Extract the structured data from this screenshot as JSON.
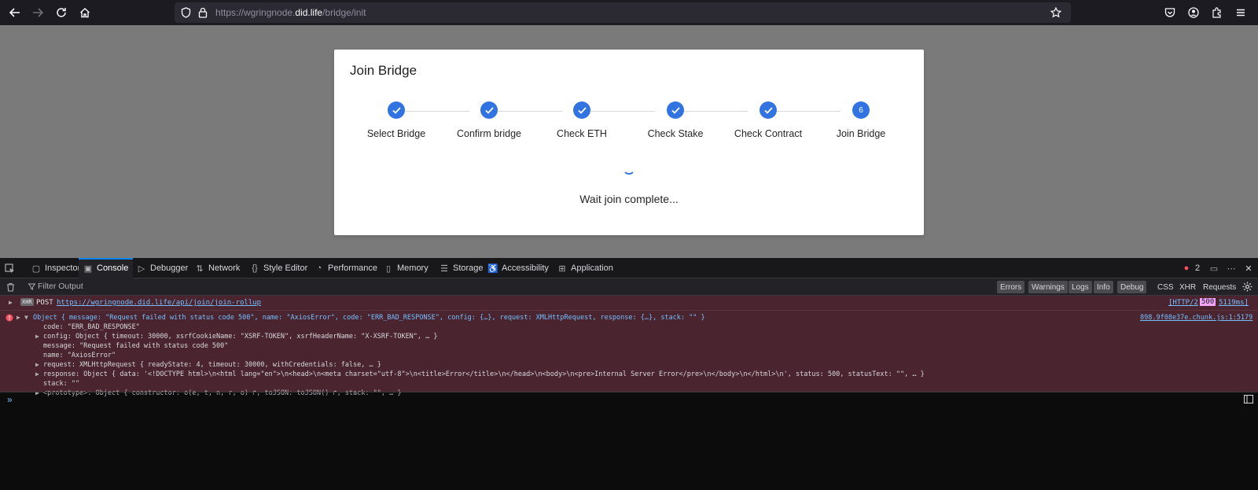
{
  "browser": {
    "url_prefix": "https://wgringnode.",
    "url_domain": "did.life",
    "url_path": "/bridge/init"
  },
  "modal": {
    "title": "Join Bridge",
    "steps": [
      {
        "label": "Select Bridge",
        "state": "done"
      },
      {
        "label": "Confirm bridge",
        "state": "done"
      },
      {
        "label": "Check ETH",
        "state": "done"
      },
      {
        "label": "Check Stake",
        "state": "done"
      },
      {
        "label": "Check Contract",
        "state": "done"
      },
      {
        "label": "Join Bridge",
        "state": "current",
        "number": "6"
      }
    ],
    "status_text": "Wait join complete..."
  },
  "devtools": {
    "tabs": [
      "Inspector",
      "Console",
      "Debugger",
      "Network",
      "Style Editor",
      "Performance",
      "Memory",
      "Storage",
      "Accessibility",
      "Application"
    ],
    "active_tab": "Console",
    "error_count": "2",
    "filter_placeholder": "Filter Output",
    "filter_levels": [
      "Errors",
      "Warnings",
      "Logs",
      "Info",
      "Debug"
    ],
    "filter_extra": [
      "CSS",
      "XHR",
      "Requests"
    ]
  },
  "console": {
    "xhr": {
      "badge": "XHR",
      "method": "POST",
      "url": "https://wgringnode.did.life/api/join/join-rollup",
      "protocol": "[HTTP/2",
      "status": "500",
      "time": "5119ms]"
    },
    "error_source": "898.9f08e37e.chunk.js:1:5179",
    "error_summary": "Object { message: \"Request failed with status code 500\", name: \"AxiosError\", code: \"ERR_BAD_RESPONSE\", config: {…}, request: XMLHttpRequest, response: {…}, stack: \"\" }",
    "lines": {
      "code": "code: \"ERR_BAD_RESPONSE\"",
      "config": "config: Object { timeout: 30000, xsrfCookieName: \"XSRF-TOKEN\", xsrfHeaderName: \"X-XSRF-TOKEN\", … }",
      "message": "message: \"Request failed with status code 500\"",
      "name": "name: \"AxiosError\"",
      "request": "request: XMLHttpRequest { readyState: 4, timeout: 30000, withCredentials: false, … }",
      "response": "response: Object { data: '<!DOCTYPE html>\\n<html lang=\"en\">\\n<head>\\n<meta charset=\"utf-8\">\\n<title>Error</title>\\n</head>\\n<body>\\n<pre>Internal Server Error</pre>\\n</body>\\n</html>\\n', status: 500, statusText: \"\", … }",
      "stack": "stack: \"\"",
      "prototype": "<prototype>: Object { constructor: o(e, t, n, r, o) ↱, toJSON: toJSON() ↱, stack: \"\", … }"
    },
    "prompt": "»"
  },
  "colors": {
    "accent": "#3173e0",
    "error_bg": "#4a2530",
    "devtools_bg": "#232327",
    "page_overlay": "#7a7a7a"
  }
}
